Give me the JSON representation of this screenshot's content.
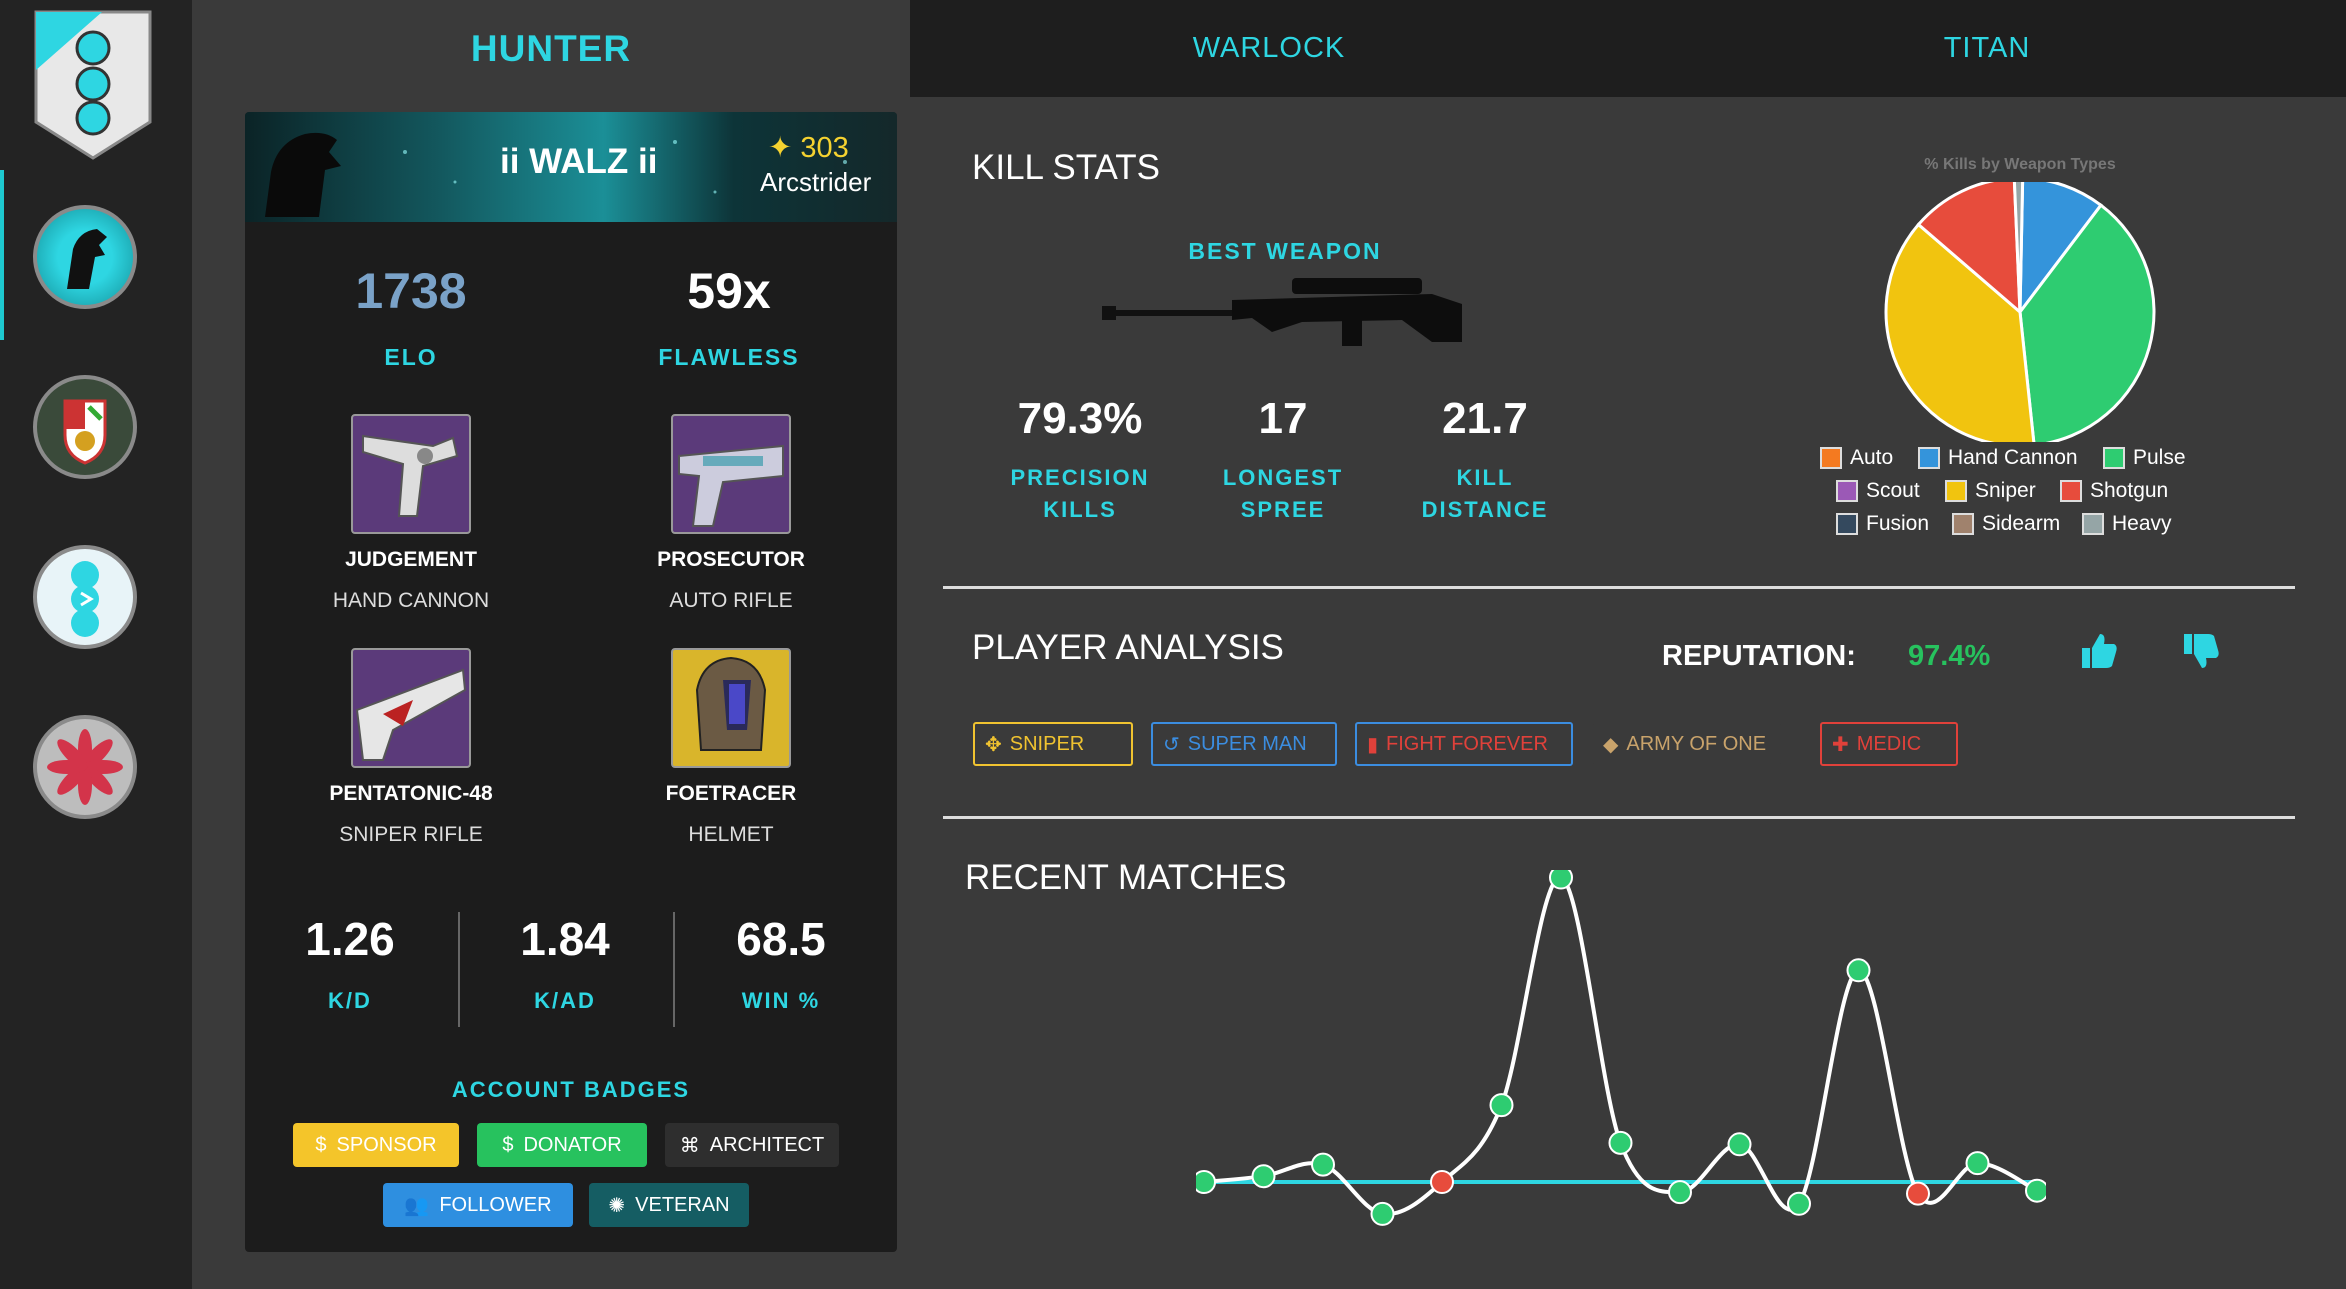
{
  "tabs": {
    "hunter": "HUNTER",
    "warlock": "WARLOCK",
    "titan": "TITAN"
  },
  "player": {
    "name": "ii WALZ ii",
    "light": "✦ 303",
    "subclass": "Arcstrider"
  },
  "stats": {
    "elo": "1738",
    "elo_label": "ELO",
    "flawless": "59x",
    "flawless_label": "FLAWLESS"
  },
  "loadout": [
    {
      "name": "JUDGEMENT",
      "type": "HAND CANNON"
    },
    {
      "name": "PROSECUTOR",
      "type": "AUTO RIFLE"
    },
    {
      "name": "PENTATONIC-48",
      "type": "SNIPER RIFLE"
    },
    {
      "name": "FOETRACER",
      "type": "HELMET"
    }
  ],
  "ratios": [
    {
      "value": "1.26",
      "label": "K/D"
    },
    {
      "value": "1.84",
      "label": "K/AD"
    },
    {
      "value": "68.5",
      "label": "WIN %"
    }
  ],
  "account_badges": {
    "title": "ACCOUNT BADGES",
    "items": [
      {
        "label": "SPONSOR",
        "icon": "$",
        "color": "#f4c52a",
        "text_color": "#fff"
      },
      {
        "label": "DONATOR",
        "icon": "$",
        "color": "#27c25e",
        "text_color": "#fff"
      },
      {
        "label": "ARCHITECT",
        "icon": "⌘",
        "color": "#2e2e2e",
        "text_color": "#fff"
      },
      {
        "label": "FOLLOWER",
        "icon": "👥",
        "color": "#2e8fe0",
        "text_color": "#fff"
      },
      {
        "label": "VETERAN",
        "icon": "✺",
        "color": "#155d63",
        "text_color": "#fff"
      }
    ]
  },
  "kill_stats": {
    "title": "KILL STATS",
    "best_weapon_label": "BEST WEAPON",
    "items": [
      {
        "value": "79.3%",
        "label_line1": "PRECISION",
        "label_line2": "KILLS"
      },
      {
        "value": "17",
        "label_line1": "LONGEST",
        "label_line2": "SPREE"
      },
      {
        "value": "21.7",
        "label_line1": "KILL",
        "label_line2": "DISTANCE"
      }
    ]
  },
  "player_analysis": {
    "title": "PLAYER ANALYSIS",
    "reputation_label": "REPUTATION:",
    "reputation_value": "97.4%",
    "traits": [
      {
        "label": "SNIPER",
        "icon": "✥",
        "color": "#f0c330"
      },
      {
        "label": "SUPER MAN",
        "icon": "↺",
        "color": "#3b8de0"
      },
      {
        "label": "FIGHT FOREVER",
        "icon": "▮",
        "color": "#e0413a"
      },
      {
        "label": "ARMY OF ONE",
        "icon": "◆",
        "color": "#c9a36b"
      },
      {
        "label": "MEDIC",
        "icon": "✚",
        "color": "#e0413a"
      }
    ]
  },
  "recent_matches": {
    "title": "RECENT MATCHES"
  },
  "chart_data": [
    {
      "type": "pie",
      "title": "% Kills by Weapon Types",
      "categories": [
        "Auto",
        "Hand Cannon",
        "Pulse",
        "Scout",
        "Sniper",
        "Shotgun",
        "Fusion",
        "Sidearm",
        "Heavy"
      ],
      "colors": [
        "#f47a20",
        "#3494db",
        "#2ecc71",
        "#9b59b6",
        "#f1c40f",
        "#e74c3c",
        "#34495e",
        "#a0826d",
        "#95a5a6"
      ],
      "values": [
        0,
        10,
        38,
        0,
        38,
        13,
        0,
        0,
        1
      ],
      "legend": "bottom"
    },
    {
      "type": "line",
      "title": "",
      "x": [
        0,
        1,
        2,
        3,
        4,
        5,
        6,
        7,
        8,
        9,
        10,
        11,
        12,
        13,
        14
      ],
      "values": [
        0,
        0.4,
        1.2,
        -2.2,
        0,
        5.3,
        21,
        2.7,
        -0.7,
        2.6,
        -1.5,
        14.6,
        -0.8,
        1.3,
        -0.6
      ],
      "baseline": 0,
      "point_colors": [
        "green",
        "green",
        "green",
        "green",
        "red",
        "green",
        "green",
        "green",
        "green",
        "green",
        "green",
        "green",
        "red",
        "green",
        "green"
      ]
    }
  ]
}
